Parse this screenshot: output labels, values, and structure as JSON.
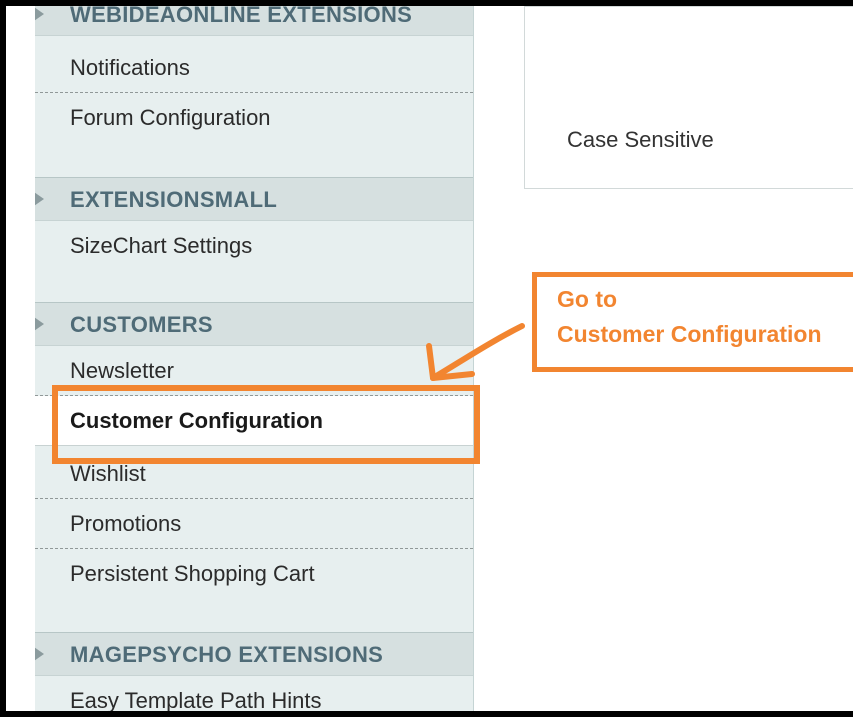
{
  "sidebar": {
    "sections": [
      {
        "title": "WEBIDEAONLINE EXTENSIONS",
        "items": [
          "Notifications",
          "Forum Configuration"
        ]
      },
      {
        "title": "EXTENSIONSMALL",
        "items": [
          "SizeChart Settings"
        ]
      },
      {
        "title": "CUSTOMERS",
        "items": [
          "Newsletter",
          "Customer Configuration",
          "Wishlist",
          "Promotions",
          "Persistent Shopping Cart"
        ]
      },
      {
        "title": "MAGEPSYCHO EXTENSIONS",
        "items": [
          "Easy Template Path Hints"
        ]
      }
    ],
    "active_item": "Customer Configuration"
  },
  "content": {
    "case_sensitive_label": "Case Sensitive"
  },
  "annotation": {
    "line1": "Go to",
    "line2": "Customer Configuration",
    "color": "#f28530"
  }
}
